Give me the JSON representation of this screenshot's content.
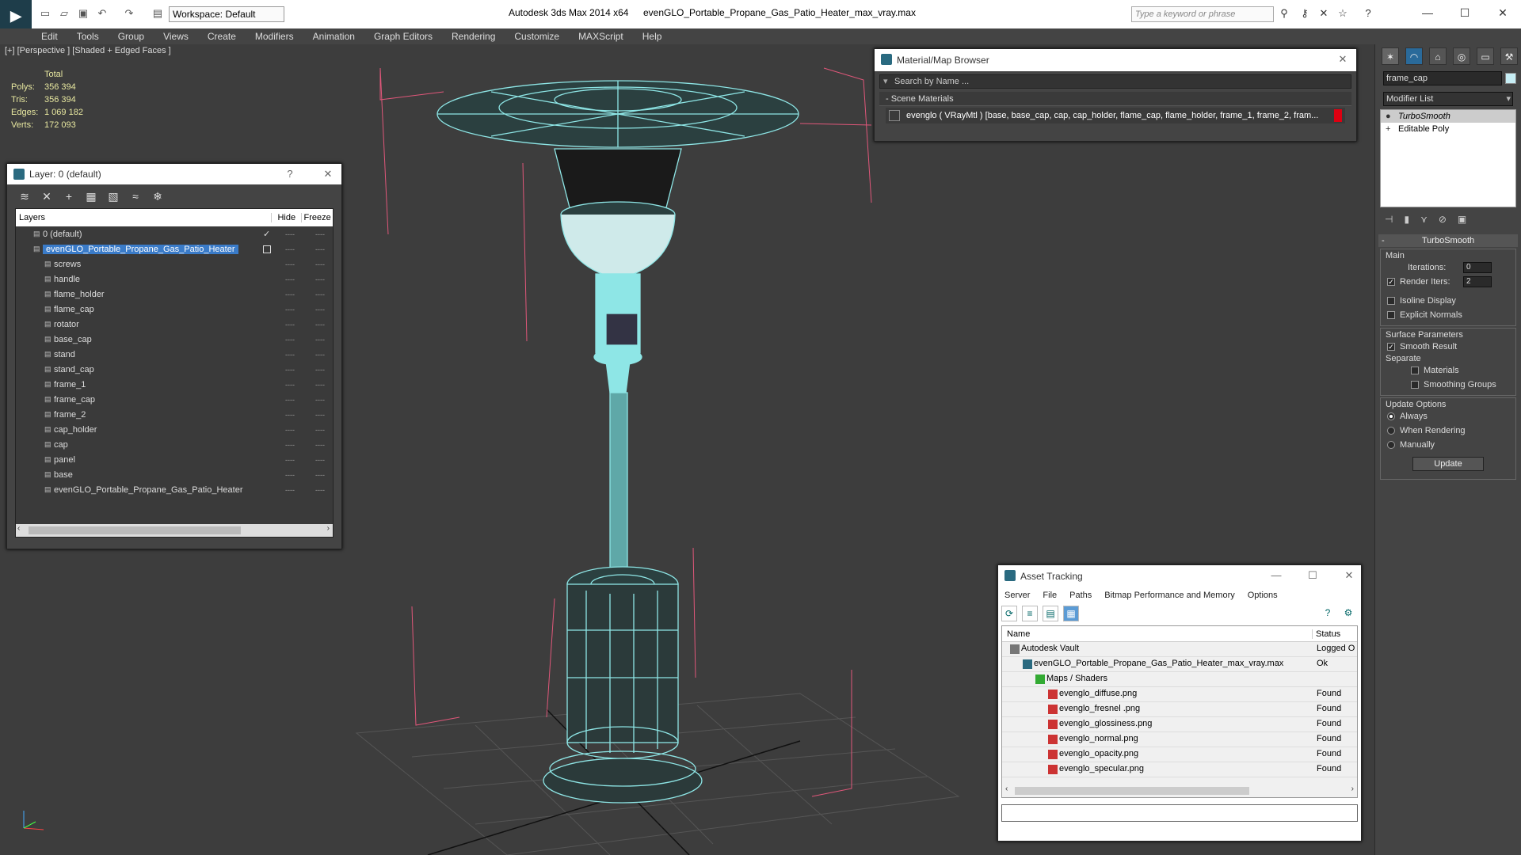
{
  "app": {
    "workspace_label": "Workspace: Default",
    "app_title": "Autodesk 3ds Max  2014 x64",
    "file_title": "evenGLO_Portable_Propane_Gas_Patio_Heater_max_vray.max",
    "search_placeholder": "Type a keyword or phrase"
  },
  "menu": [
    "Edit",
    "Tools",
    "Group",
    "Views",
    "Create",
    "Modifiers",
    "Animation",
    "Graph Editors",
    "Rendering",
    "Customize",
    "MAXScript",
    "Help"
  ],
  "viewport": {
    "label": "[+] [Perspective ] [Shaded + Edged Faces ]",
    "stats": {
      "header": "Total",
      "rows": [
        {
          "label": "Polys:",
          "value": "356 394"
        },
        {
          "label": "Tris:",
          "value": "356 394"
        },
        {
          "label": "Edges:",
          "value": "1 069 182"
        },
        {
          "label": "Verts:",
          "value": "172 093"
        }
      ]
    }
  },
  "layer_panel": {
    "title": "Layer: 0 (default)",
    "help": "?",
    "col_layers": "Layers",
    "col_hide": "Hide",
    "col_freeze": "Freeze",
    "rows": [
      {
        "name": "0 (default)",
        "level": 0
      },
      {
        "name": "evenGLO_Portable_Propane_Gas_Patio_Heater",
        "level": 0,
        "selected": true
      },
      {
        "name": "screws",
        "level": 1
      },
      {
        "name": "handle",
        "level": 1
      },
      {
        "name": "flame_holder",
        "level": 1
      },
      {
        "name": "flame_cap",
        "level": 1
      },
      {
        "name": "rotator",
        "level": 1
      },
      {
        "name": "base_cap",
        "level": 1
      },
      {
        "name": "stand",
        "level": 1
      },
      {
        "name": "stand_cap",
        "level": 1
      },
      {
        "name": "frame_1",
        "level": 1
      },
      {
        "name": "frame_cap",
        "level": 1
      },
      {
        "name": "frame_2",
        "level": 1
      },
      {
        "name": "cap_holder",
        "level": 1
      },
      {
        "name": "cap",
        "level": 1
      },
      {
        "name": "panel",
        "level": 1
      },
      {
        "name": "base",
        "level": 1
      },
      {
        "name": "evenGLO_Portable_Propane_Gas_Patio_Heater",
        "level": 1
      }
    ],
    "dash": "----"
  },
  "material_browser": {
    "title": "Material/Map Browser",
    "search_placeholder": "Search by Name ...",
    "section": "- Scene Materials",
    "item": "evenglo  ( VRayMtl )  [base, base_cap, cap, cap_holder, flame_cap, flame_holder, frame_1, frame_2, fram..."
  },
  "asset_tracking": {
    "title": "Asset Tracking",
    "menu": [
      "Server",
      "File",
      "Paths",
      "Bitmap Performance and Memory",
      "Options"
    ],
    "col_name": "Name",
    "col_status": "Status",
    "rows": [
      {
        "name": "Autodesk Vault",
        "status": "Logged O",
        "indent": 24,
        "icon": "vault-icon"
      },
      {
        "name": "evenGLO_Portable_Propane_Gas_Patio_Heater_max_vray.max",
        "status": "Ok",
        "indent": 40,
        "icon": "max-file-icon"
      },
      {
        "name": "Maps / Shaders",
        "status": "",
        "indent": 56,
        "icon": "maps-folder-icon"
      },
      {
        "name": "evenglo_diffuse.png",
        "status": "Found",
        "indent": 72,
        "icon": "png-icon"
      },
      {
        "name": "evenglo_fresnel .png",
        "status": "Found",
        "indent": 72,
        "icon": "png-icon"
      },
      {
        "name": "evenglo_glossiness.png",
        "status": "Found",
        "indent": 72,
        "icon": "png-icon"
      },
      {
        "name": "evenglo_normal.png",
        "status": "Found",
        "indent": 72,
        "icon": "png-icon"
      },
      {
        "name": "evenglo_opacity.png",
        "status": "Found",
        "indent": 72,
        "icon": "png-icon"
      },
      {
        "name": "evenglo_specular.png",
        "status": "Found",
        "indent": 72,
        "icon": "png-icon"
      }
    ]
  },
  "command_panel": {
    "object_name": "frame_cap",
    "modifier_list": "Modifier List",
    "stack": [
      "TurboSmooth",
      "Editable Poly"
    ],
    "rollout_title": "TurboSmooth",
    "main_label": "Main",
    "iterations_label": "Iterations:",
    "iterations_value": "0",
    "render_iters_label": "Render Iters:",
    "render_iters_value": "2",
    "isoline_label": "Isoline Display",
    "explicit_normals_label": "Explicit Normals",
    "surface_params_label": "Surface Parameters",
    "smooth_result_label": "Smooth Result",
    "separate_label": "Separate",
    "materials_label": "Materials",
    "smoothing_groups_label": "Smoothing Groups",
    "update_options_label": "Update Options",
    "always_label": "Always",
    "when_rendering_label": "When Rendering",
    "manually_label": "Manually",
    "update_button": "Update"
  }
}
